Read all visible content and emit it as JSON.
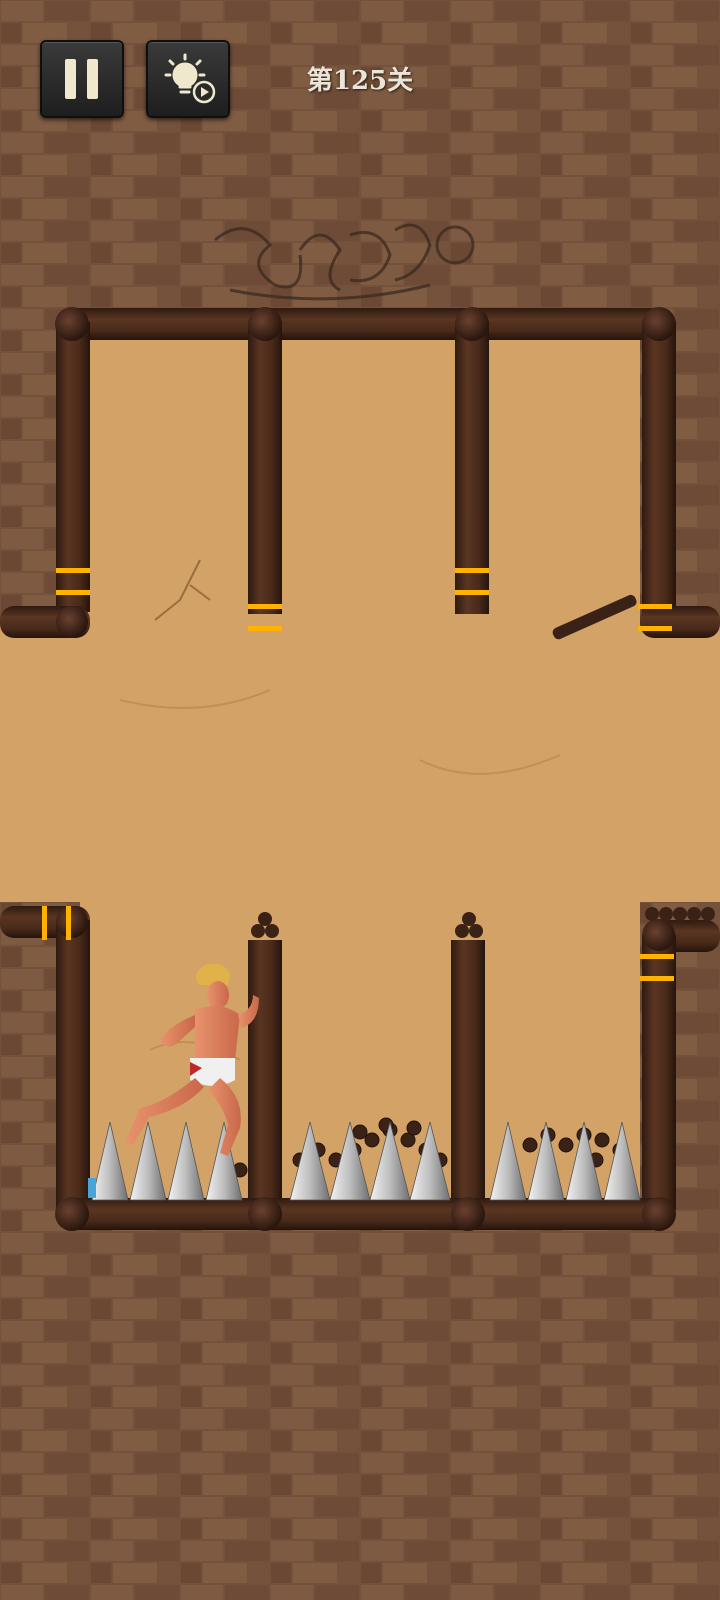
{
  "hud": {
    "level_label": "第125关",
    "pause_icon": "pause-icon",
    "hint_icon": "lightbulb-video-icon"
  },
  "graffiti_text": "SAGE",
  "scene": {
    "pins": 8,
    "colors": {
      "stone": "#7a5740",
      "chamber": "#d4a367",
      "wood": "#4a2b1c",
      "pin_band": "#ffb300",
      "spike": "#cfcfcf"
    }
  }
}
